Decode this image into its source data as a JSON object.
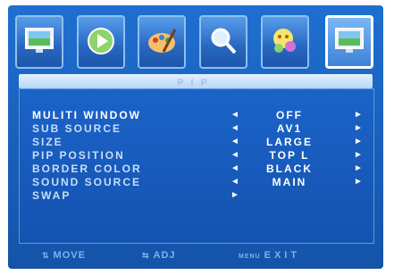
{
  "menu_title": "PIP",
  "icons": [
    {
      "name": "picture-icon",
      "active": false
    },
    {
      "name": "play-icon",
      "active": false
    },
    {
      "name": "palette-icon",
      "active": false
    },
    {
      "name": "magnifier-icon",
      "active": false
    },
    {
      "name": "setup-icon",
      "active": false
    },
    {
      "name": "pip-icon",
      "active": true
    }
  ],
  "rows": [
    {
      "label": "MULITI WINDOW",
      "value": "OFF",
      "left_arrow": "◄",
      "right_arrow": "►",
      "selected": true
    },
    {
      "label": "SUB SOURCE",
      "value": "AV1",
      "left_arrow": "◄",
      "right_arrow": "►"
    },
    {
      "label": "SIZE",
      "value": "LARGE",
      "left_arrow": "◄",
      "right_arrow": "►"
    },
    {
      "label": "PIP POSITION",
      "value": "TOP L",
      "left_arrow": "◄",
      "right_arrow": "►"
    },
    {
      "label": "BORDER COLOR",
      "value": "BLACK",
      "left_arrow": "◄",
      "right_arrow": "►"
    },
    {
      "label": "SOUND SOURCE",
      "value": "MAIN",
      "left_arrow": "◄",
      "right_arrow": "►"
    },
    {
      "label": "SWAP",
      "value": "",
      "left_arrow": "►",
      "right_arrow": ""
    }
  ],
  "footer": {
    "move_glyph": "⇅",
    "move_label": "MOVE",
    "adjust_glyph": "⇆",
    "adjust_label": "ADJ",
    "menu_glyph": "MENU",
    "exit_label": "EXIT"
  }
}
